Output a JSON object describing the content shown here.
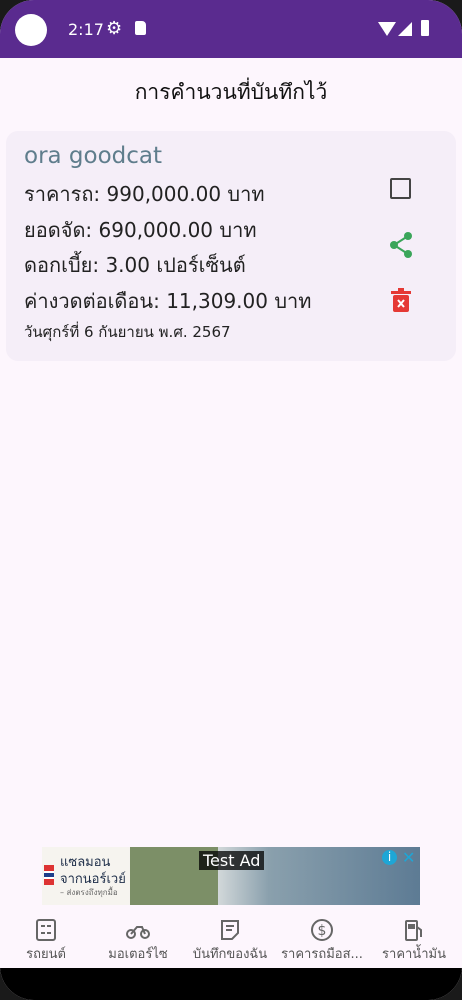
{
  "status": {
    "time": "2:17"
  },
  "page": {
    "title": "การคำนวนที่บันทึกไว้"
  },
  "card": {
    "model": "ora goodcat",
    "price": "ราคารถ: 990,000.00 บาท",
    "financed": "ยอดจัด: 690,000.00 บาท",
    "interest": "ดอกเบี้ย: 3.00 เปอร์เซ็นต์",
    "monthly": "ค่างวดต่อเดือน: 11,309.00 บาท",
    "date": "วันศุกร์ที่ 6 กันยายน พ.ศ. 2567"
  },
  "ad": {
    "label": "Test Ad",
    "headline1": "แซลมอน",
    "headline2": "จากนอร์เวย์",
    "subtext": "– ส่งตรงถึงทุกมื้อ"
  },
  "nav": [
    {
      "label": "รถยนต์",
      "icon": "calculator-icon"
    },
    {
      "label": "มอเตอร์ไซ",
      "icon": "motorcycle-icon"
    },
    {
      "label": "บันทึกของฉัน",
      "icon": "notes-icon"
    },
    {
      "label": "ราคารถมือส...",
      "icon": "dollar-icon"
    },
    {
      "label": "ราคาน้ำมัน",
      "icon": "fuel-icon"
    }
  ],
  "colors": {
    "statusbar": "#5a2b8f",
    "share": "#3aa55a",
    "delete": "#e53935",
    "model": "#5f7d8c"
  }
}
